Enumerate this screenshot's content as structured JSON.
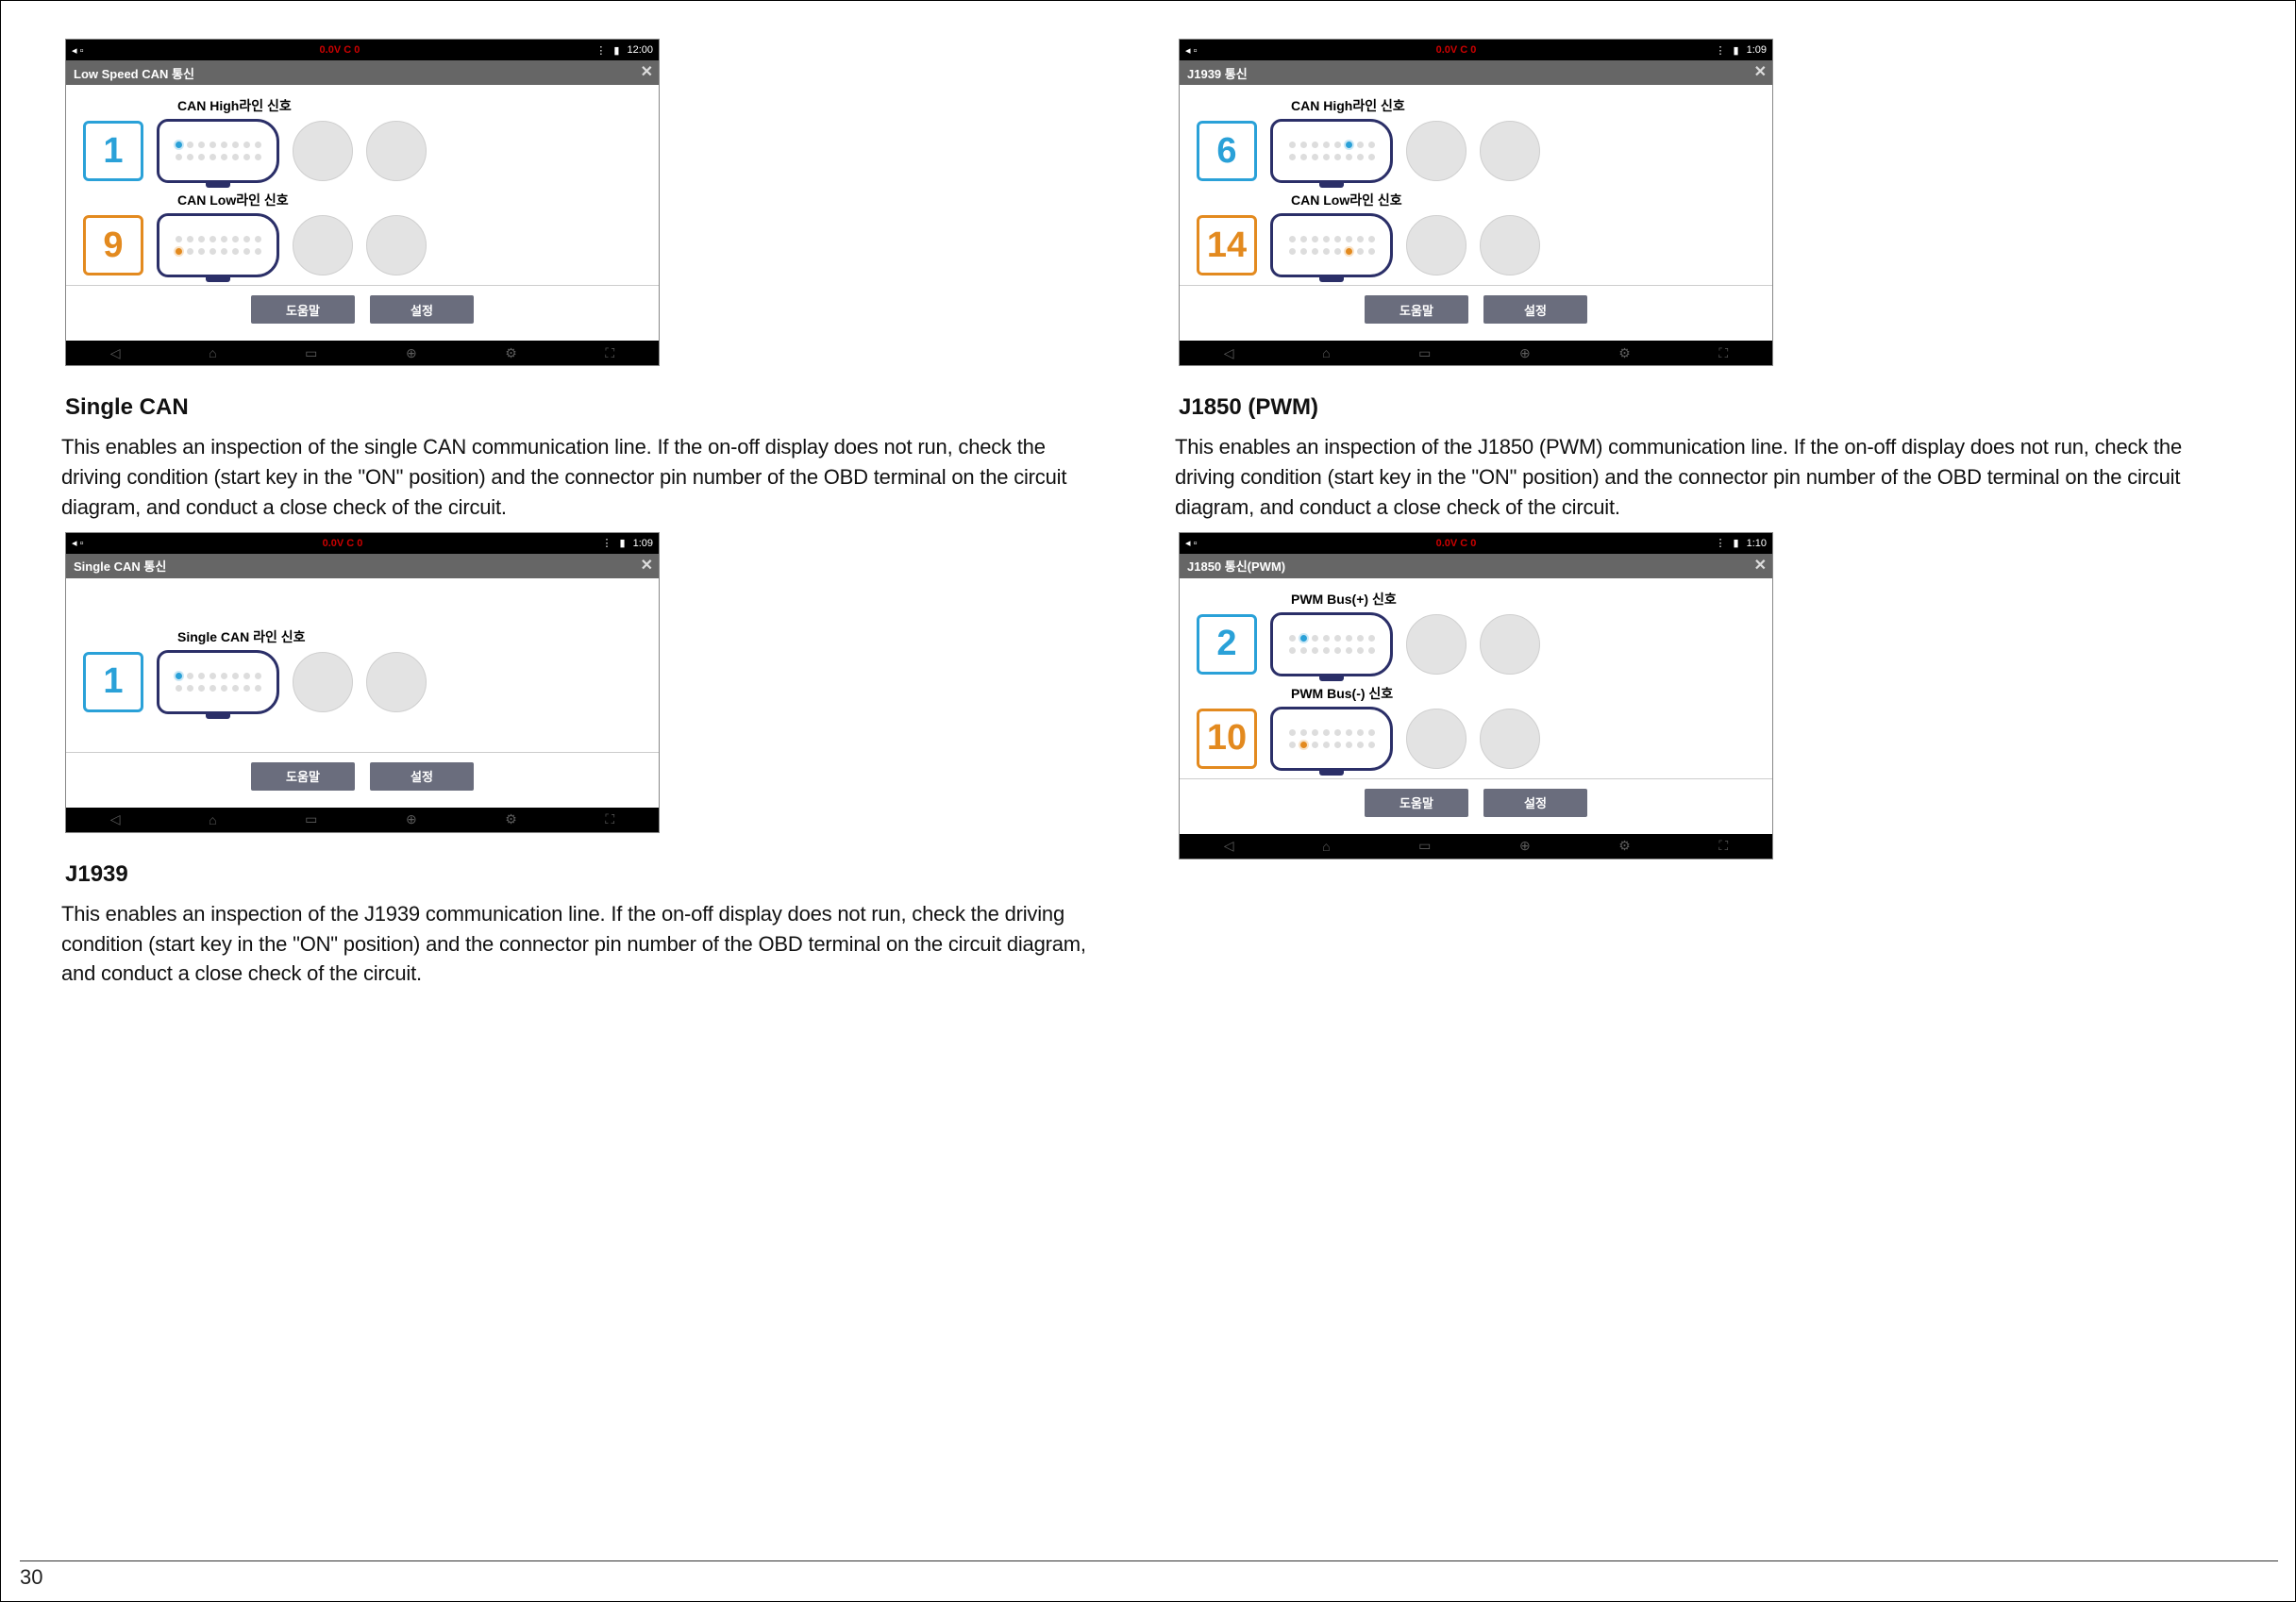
{
  "page_number": "30",
  "common": {
    "status_voltage": "0.0V C 0",
    "help": "도움말",
    "settings": "설정",
    "close_glyph": "✕"
  },
  "left": {
    "s1": {
      "screenshot": {
        "title": "Low Speed CAN 통신",
        "time": "12:00",
        "rows": [
          {
            "label": "CAN High라인 신호",
            "pin": "1",
            "color": "blue"
          },
          {
            "label": "CAN Low라인 신호",
            "pin": "9",
            "color": "orange"
          }
        ]
      }
    },
    "s2": {
      "heading": "Single CAN",
      "body": "This enables an inspection of the single CAN communication line. If the on-off display does not run, check the driving condition (start key in the \"ON\" position) and the connector pin number of the OBD terminal on the circuit diagram, and conduct a close check of the circuit.",
      "screenshot": {
        "title": "Single CAN 통신",
        "time": "1:09",
        "rows": [
          {
            "label": "Single CAN 라인 신호",
            "pin": "1",
            "color": "blue"
          }
        ]
      }
    },
    "s3": {
      "heading": "J1939",
      "body": "This enables an inspection of the J1939 communication line. If the on-off display does not run, check the driving condition (start key in the \"ON\" position) and the connector pin number of the OBD terminal on the circuit diagram, and conduct a close check of the circuit."
    }
  },
  "right": {
    "s1": {
      "screenshot": {
        "title": "J1939 통신",
        "time": "1:09",
        "rows": [
          {
            "label": "CAN High라인 신호",
            "pin": "6",
            "color": "blue"
          },
          {
            "label": "CAN Low라인 신호",
            "pin": "14",
            "color": "orange"
          }
        ]
      }
    },
    "s2": {
      "heading": "J1850 (PWM)",
      "body": "This enables an inspection of the J1850 (PWM) communication line. If the on-off display does not run, check the driving condition (start key in the \"ON\" position) and the connector pin number of the OBD terminal on the circuit diagram, and conduct a close check of the circuit.",
      "screenshot": {
        "title": "J1850 통신(PWM)",
        "time": "1:10",
        "rows": [
          {
            "label": "PWM Bus(+) 신호",
            "pin": "2",
            "color": "blue"
          },
          {
            "label": "PWM Bus(-) 신호",
            "pin": "10",
            "color": "orange"
          }
        ]
      }
    }
  }
}
